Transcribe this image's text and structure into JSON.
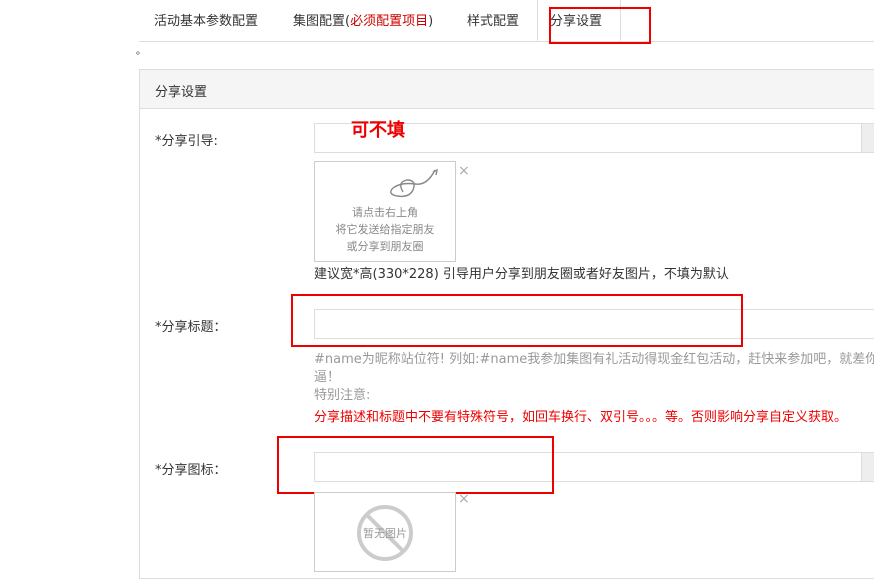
{
  "tabs": [
    {
      "label": "活动基本参数配置"
    },
    {
      "label": "集图配置(",
      "required": "必须配置项目",
      "suffix": ")"
    },
    {
      "label": "样式配置"
    },
    {
      "label": "分享设置"
    }
  ],
  "dot": "。",
  "panel": {
    "title": "分享设置"
  },
  "share_guide": {
    "label": "*分享引导:",
    "annotation": "可不填",
    "watermark_line1": "请点击右上角",
    "watermark_line2": "将它发送给指定朋友",
    "watermark_line3": "或分享到朋友圈",
    "hint": "建议宽*高(330*228) 引导用户分享到朋友圈或者好友图片，不填为默认"
  },
  "share_title": {
    "label": "*分享标题：",
    "help_line1": "#name为昵称站位符! 列如:#name我参加集图有礼活动得现金红包活动，赶快来参加吧，就差你",
    "help_line2": "逼！",
    "help_line3": "特别注意:",
    "warning": "分享描述和标题中不要有特殊符号，如回车换行、双引号。。。等。否则影响分享自定义获取。"
  },
  "share_icon": {
    "label": "*分享图标：",
    "no_image": "暂无图片"
  },
  "close_glyph": "×",
  "colors": {
    "accent_red": "#e00000",
    "border": "#dddddd",
    "panel_head": "#f5f5f5"
  }
}
